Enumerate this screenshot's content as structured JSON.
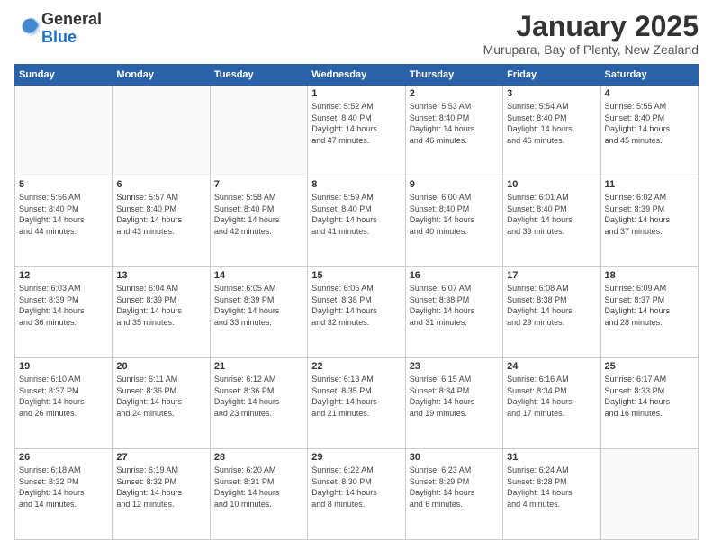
{
  "logo": {
    "general": "General",
    "blue": "Blue"
  },
  "header": {
    "month": "January 2025",
    "location": "Murupara, Bay of Plenty, New Zealand"
  },
  "weekdays": [
    "Sunday",
    "Monday",
    "Tuesday",
    "Wednesday",
    "Thursday",
    "Friday",
    "Saturday"
  ],
  "weeks": [
    [
      {
        "day": "",
        "info": ""
      },
      {
        "day": "",
        "info": ""
      },
      {
        "day": "",
        "info": ""
      },
      {
        "day": "1",
        "info": "Sunrise: 5:52 AM\nSunset: 8:40 PM\nDaylight: 14 hours\nand 47 minutes."
      },
      {
        "day": "2",
        "info": "Sunrise: 5:53 AM\nSunset: 8:40 PM\nDaylight: 14 hours\nand 46 minutes."
      },
      {
        "day": "3",
        "info": "Sunrise: 5:54 AM\nSunset: 8:40 PM\nDaylight: 14 hours\nand 46 minutes."
      },
      {
        "day": "4",
        "info": "Sunrise: 5:55 AM\nSunset: 8:40 PM\nDaylight: 14 hours\nand 45 minutes."
      }
    ],
    [
      {
        "day": "5",
        "info": "Sunrise: 5:56 AM\nSunset: 8:40 PM\nDaylight: 14 hours\nand 44 minutes."
      },
      {
        "day": "6",
        "info": "Sunrise: 5:57 AM\nSunset: 8:40 PM\nDaylight: 14 hours\nand 43 minutes."
      },
      {
        "day": "7",
        "info": "Sunrise: 5:58 AM\nSunset: 8:40 PM\nDaylight: 14 hours\nand 42 minutes."
      },
      {
        "day": "8",
        "info": "Sunrise: 5:59 AM\nSunset: 8:40 PM\nDaylight: 14 hours\nand 41 minutes."
      },
      {
        "day": "9",
        "info": "Sunrise: 6:00 AM\nSunset: 8:40 PM\nDaylight: 14 hours\nand 40 minutes."
      },
      {
        "day": "10",
        "info": "Sunrise: 6:01 AM\nSunset: 8:40 PM\nDaylight: 14 hours\nand 39 minutes."
      },
      {
        "day": "11",
        "info": "Sunrise: 6:02 AM\nSunset: 8:39 PM\nDaylight: 14 hours\nand 37 minutes."
      }
    ],
    [
      {
        "day": "12",
        "info": "Sunrise: 6:03 AM\nSunset: 8:39 PM\nDaylight: 14 hours\nand 36 minutes."
      },
      {
        "day": "13",
        "info": "Sunrise: 6:04 AM\nSunset: 8:39 PM\nDaylight: 14 hours\nand 35 minutes."
      },
      {
        "day": "14",
        "info": "Sunrise: 6:05 AM\nSunset: 8:39 PM\nDaylight: 14 hours\nand 33 minutes."
      },
      {
        "day": "15",
        "info": "Sunrise: 6:06 AM\nSunset: 8:38 PM\nDaylight: 14 hours\nand 32 minutes."
      },
      {
        "day": "16",
        "info": "Sunrise: 6:07 AM\nSunset: 8:38 PM\nDaylight: 14 hours\nand 31 minutes."
      },
      {
        "day": "17",
        "info": "Sunrise: 6:08 AM\nSunset: 8:38 PM\nDaylight: 14 hours\nand 29 minutes."
      },
      {
        "day": "18",
        "info": "Sunrise: 6:09 AM\nSunset: 8:37 PM\nDaylight: 14 hours\nand 28 minutes."
      }
    ],
    [
      {
        "day": "19",
        "info": "Sunrise: 6:10 AM\nSunset: 8:37 PM\nDaylight: 14 hours\nand 26 minutes."
      },
      {
        "day": "20",
        "info": "Sunrise: 6:11 AM\nSunset: 8:36 PM\nDaylight: 14 hours\nand 24 minutes."
      },
      {
        "day": "21",
        "info": "Sunrise: 6:12 AM\nSunset: 8:36 PM\nDaylight: 14 hours\nand 23 minutes."
      },
      {
        "day": "22",
        "info": "Sunrise: 6:13 AM\nSunset: 8:35 PM\nDaylight: 14 hours\nand 21 minutes."
      },
      {
        "day": "23",
        "info": "Sunrise: 6:15 AM\nSunset: 8:34 PM\nDaylight: 14 hours\nand 19 minutes."
      },
      {
        "day": "24",
        "info": "Sunrise: 6:16 AM\nSunset: 8:34 PM\nDaylight: 14 hours\nand 17 minutes."
      },
      {
        "day": "25",
        "info": "Sunrise: 6:17 AM\nSunset: 8:33 PM\nDaylight: 14 hours\nand 16 minutes."
      }
    ],
    [
      {
        "day": "26",
        "info": "Sunrise: 6:18 AM\nSunset: 8:32 PM\nDaylight: 14 hours\nand 14 minutes."
      },
      {
        "day": "27",
        "info": "Sunrise: 6:19 AM\nSunset: 8:32 PM\nDaylight: 14 hours\nand 12 minutes."
      },
      {
        "day": "28",
        "info": "Sunrise: 6:20 AM\nSunset: 8:31 PM\nDaylight: 14 hours\nand 10 minutes."
      },
      {
        "day": "29",
        "info": "Sunrise: 6:22 AM\nSunset: 8:30 PM\nDaylight: 14 hours\nand 8 minutes."
      },
      {
        "day": "30",
        "info": "Sunrise: 6:23 AM\nSunset: 8:29 PM\nDaylight: 14 hours\nand 6 minutes."
      },
      {
        "day": "31",
        "info": "Sunrise: 6:24 AM\nSunset: 8:28 PM\nDaylight: 14 hours\nand 4 minutes."
      },
      {
        "day": "",
        "info": ""
      }
    ]
  ]
}
